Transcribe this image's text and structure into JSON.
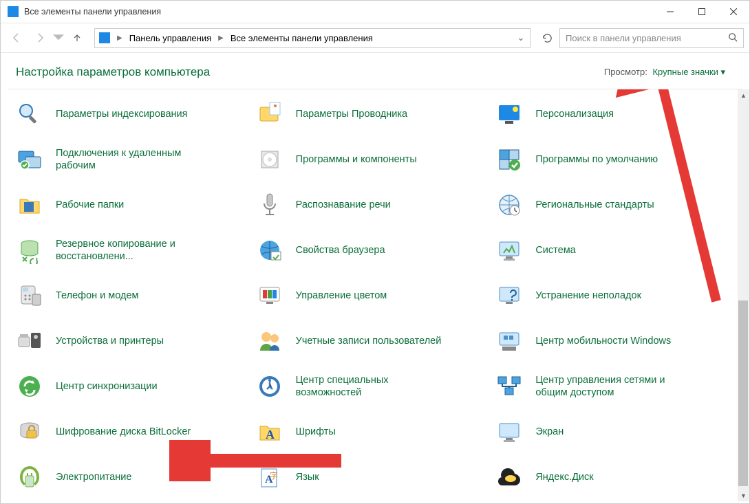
{
  "window": {
    "title": "Все элементы панели управления"
  },
  "navbar": {
    "breadcrumb1": "Панель управления",
    "breadcrumb2": "Все элементы панели управления"
  },
  "search": {
    "placeholder": "Поиск в панели управления"
  },
  "heading": {
    "title": "Настройка параметров компьютера",
    "view_label": "Просмотр:",
    "view_value": "Крупные значки"
  },
  "items": [
    {
      "label": "Параметры индексирования",
      "icon": "magnifier"
    },
    {
      "label": "Параметры Проводника",
      "icon": "folder-options"
    },
    {
      "label": "Персонализация",
      "icon": "personalization"
    },
    {
      "label": "Подключения к удаленным рабочим",
      "icon": "remote"
    },
    {
      "label": "Программы и компоненты",
      "icon": "programs"
    },
    {
      "label": "Программы по умолчанию",
      "icon": "defaults"
    },
    {
      "label": "Рабочие папки",
      "icon": "workfolders"
    },
    {
      "label": "Распознавание речи",
      "icon": "mic"
    },
    {
      "label": "Региональные стандарты",
      "icon": "region"
    },
    {
      "label": "Резервное копирование и восстановлени...",
      "icon": "backup"
    },
    {
      "label": "Свойства браузера",
      "icon": "internet"
    },
    {
      "label": "Система",
      "icon": "system"
    },
    {
      "label": "Телефон и модем",
      "icon": "phone"
    },
    {
      "label": "Управление цветом",
      "icon": "color"
    },
    {
      "label": "Устранение неполадок",
      "icon": "troubleshoot"
    },
    {
      "label": "Устройства и принтеры",
      "icon": "devices"
    },
    {
      "label": "Учетные записи пользователей",
      "icon": "users"
    },
    {
      "label": "Центр мобильности Windows",
      "icon": "mobility"
    },
    {
      "label": "Центр синхронизации",
      "icon": "sync"
    },
    {
      "label": "Центр специальных возможностей",
      "icon": "ease"
    },
    {
      "label": "Центр управления сетями и общим доступом",
      "icon": "network"
    },
    {
      "label": "Шифрование диска BitLocker",
      "icon": "bitlocker"
    },
    {
      "label": "Шрифты",
      "icon": "fonts"
    },
    {
      "label": "Экран",
      "icon": "display"
    },
    {
      "label": "Электропитание",
      "icon": "power"
    },
    {
      "label": "Язык",
      "icon": "lang"
    },
    {
      "label": "Яндекс.Диск",
      "icon": "yadisk"
    }
  ]
}
